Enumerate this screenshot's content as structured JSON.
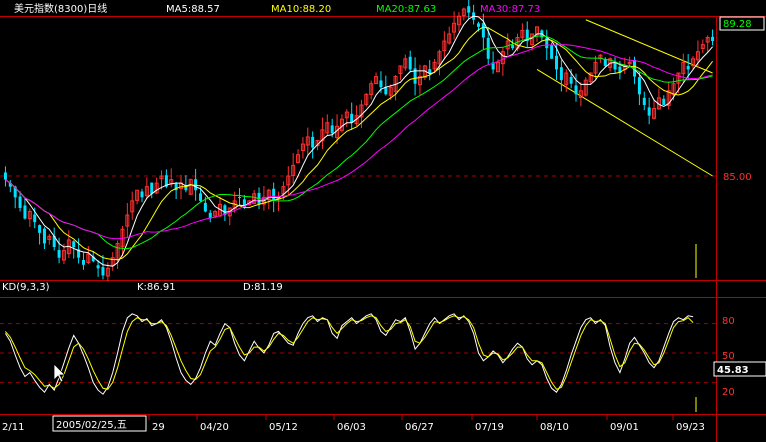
{
  "header": {
    "title": "美元指数(8300)日线",
    "ma5": "MA5:88.57",
    "ma10": "MA10:88.20",
    "ma20": "MA20:87.63",
    "ma30": "MA30:87.73"
  },
  "kd_header": {
    "name": "KD(9,3,3)",
    "k": "K:86.91",
    "d": "D:81.19"
  },
  "right_axis": {
    "price_top": "89.28",
    "price_mid": "85.00",
    "kd_80": "80",
    "kd_50": "50",
    "kd_20": "20",
    "kd_current": "45.83"
  },
  "cursor_date": "2005/02/25,五",
  "x_labels": [
    "2/11",
    "29",
    "04/20",
    "05/12",
    "06/03",
    "06/27",
    "07/19",
    "08/10",
    "09/01",
    "09/23"
  ],
  "colors": {
    "background": "#000000",
    "up": "#ff3030",
    "down": "#00e0ff",
    "ma5": "#ffffff",
    "ma10": "#ffff00",
    "ma20": "#00ff00",
    "ma30": "#ff00ff",
    "grid": "#a00000",
    "border": "#c00000",
    "channel": "#ffff00",
    "k_line": "#ffffff",
    "d_line": "#ffff00"
  },
  "chart_data": [
    {
      "type": "candlestick",
      "title": "美元指数(8300)日线",
      "y_reference": [
        85.0,
        89.28
      ],
      "closes": [
        84.9,
        84.7,
        84.4,
        84.1,
        83.8,
        84.0,
        83.7,
        83.4,
        83.1,
        83.3,
        83.0,
        82.7,
        82.9,
        83.2,
        83.0,
        82.7,
        82.5,
        82.8,
        82.6,
        82.4,
        82.2,
        82.4,
        82.7,
        83.1,
        83.5,
        83.9,
        84.3,
        84.6,
        84.4,
        84.7,
        84.5,
        84.8,
        85.0,
        84.7,
        84.9,
        84.6,
        84.8,
        84.6,
        84.9,
        84.6,
        84.3,
        84.0,
        83.8,
        84.0,
        84.2,
        83.9,
        84.1,
        84.3,
        84.4,
        84.1,
        84.3,
        84.5,
        84.2,
        84.4,
        84.6,
        84.3,
        84.4,
        84.7,
        85.0,
        85.3,
        85.6,
        85.9,
        86.1,
        85.8,
        86.0,
        86.3,
        86.5,
        86.2,
        86.4,
        86.6,
        86.8,
        86.5,
        86.7,
        87.0,
        87.3,
        87.6,
        87.8,
        87.5,
        87.3,
        87.5,
        87.8,
        88.1,
        88.3,
        88.0,
        87.6,
        87.8,
        88.1,
        87.9,
        88.2,
        88.5,
        88.8,
        89.0,
        89.3,
        89.5,
        89.7,
        89.6,
        89.4,
        89.2,
        88.9,
        88.3,
        88.0,
        88.2,
        88.5,
        88.8,
        88.6,
        88.9,
        89.1,
        88.8,
        89.0,
        89.2,
        88.9,
        88.6,
        88.3,
        88.0,
        87.7,
        87.9,
        87.6,
        87.3,
        87.4,
        87.7,
        87.9,
        88.2,
        88.4,
        88.1,
        88.3,
        88.0,
        87.9,
        88.1,
        88.2,
        87.8,
        87.3,
        87.0,
        86.7,
        86.9,
        87.2,
        87.0,
        87.4,
        87.6,
        87.9,
        88.2,
        88.0,
        88.3,
        88.5,
        88.7,
        88.9,
        88.8
      ],
      "ma_values": {
        "MA5": 88.57,
        "MA10": 88.2,
        "MA20": 87.63,
        "MA30": 87.73
      },
      "channel": {
        "upper": [
          [
            119,
            89.4
          ],
          [
            145,
            87.9
          ]
        ],
        "lower": [
          [
            109,
            88.0
          ],
          [
            145,
            85.0
          ]
        ]
      }
    },
    {
      "type": "line",
      "title": "KD(9,3,3)",
      "levels": [
        20,
        50,
        80
      ],
      "ylim": [
        0,
        100
      ],
      "series": [
        {
          "name": "K",
          "values": [
            70,
            62,
            48,
            35,
            26,
            30,
            22,
            15,
            10,
            18,
            12,
            25,
            40,
            55,
            68,
            60,
            48,
            35,
            20,
            12,
            8,
            15,
            30,
            50,
            72,
            86,
            90,
            88,
            82,
            85,
            78,
            80,
            84,
            76,
            62,
            45,
            30,
            22,
            18,
            24,
            35,
            50,
            62,
            58,
            70,
            80,
            76,
            60,
            48,
            42,
            52,
            62,
            55,
            50,
            58,
            70,
            72,
            66,
            60,
            58,
            70,
            80,
            86,
            88,
            82,
            86,
            84,
            70,
            65,
            78,
            82,
            86,
            80,
            84,
            88,
            90,
            84,
            72,
            68,
            76,
            84,
            82,
            86,
            72,
            54,
            60,
            70,
            80,
            86,
            80,
            84,
            88,
            90,
            84,
            88,
            82,
            70,
            50,
            42,
            46,
            52,
            48,
            40,
            46,
            54,
            60,
            56,
            44,
            38,
            42,
            38,
            24,
            14,
            10,
            18,
            32,
            48,
            62,
            76,
            84,
            86,
            80,
            84,
            78,
            56,
            40,
            30,
            44,
            60,
            66,
            58,
            50,
            40,
            35,
            42,
            56,
            70,
            82,
            86,
            84,
            88,
            87
          ]
        },
        {
          "name": "D",
          "values": [
            72,
            66,
            56,
            45,
            35,
            32,
            28,
            22,
            16,
            17,
            14,
            18,
            28,
            42,
            56,
            60,
            54,
            44,
            32,
            22,
            14,
            13,
            20,
            35,
            54,
            72,
            82,
            86,
            84,
            84,
            80,
            80,
            82,
            78,
            68,
            55,
            42,
            32,
            24,
            23,
            28,
            40,
            52,
            56,
            64,
            74,
            76,
            66,
            56,
            48,
            50,
            56,
            56,
            52,
            56,
            64,
            70,
            68,
            63,
            60,
            66,
            74,
            82,
            86,
            84,
            85,
            84,
            76,
            70,
            75,
            80,
            84,
            82,
            83,
            86,
            88,
            86,
            78,
            72,
            74,
            80,
            81,
            84,
            77,
            62,
            60,
            66,
            74,
            82,
            81,
            83,
            86,
            88,
            86,
            87,
            84,
            76,
            60,
            48,
            46,
            50,
            49,
            43,
            45,
            50,
            56,
            56,
            48,
            42,
            42,
            40,
            30,
            20,
            13,
            15,
            26,
            40,
            54,
            68,
            78,
            84,
            82,
            83,
            80,
            64,
            48,
            36,
            40,
            52,
            60,
            59,
            53,
            45,
            38,
            40,
            50,
            63,
            76,
            82,
            83,
            86,
            81
          ]
        }
      ]
    }
  ]
}
